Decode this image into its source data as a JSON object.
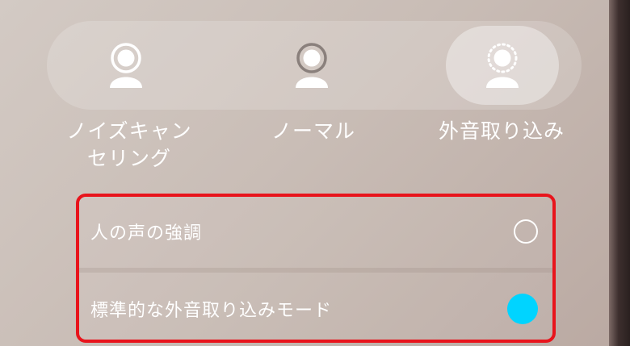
{
  "modes": [
    {
      "label": "ノイズキャン\nセリング",
      "icon": "noise-cancelling-person-icon",
      "selected": false
    },
    {
      "label": "ノーマル",
      "icon": "normal-person-icon",
      "selected": false
    },
    {
      "label": "外音取り込み",
      "icon": "ambient-sound-person-icon",
      "selected": true
    }
  ],
  "options": [
    {
      "label": "人の声の強調",
      "checked": false
    },
    {
      "label": "標準的な外音取り込みモード",
      "checked": true
    }
  ],
  "colors": {
    "highlight_border": "#e8141c",
    "radio_active": "#00d4ff"
  }
}
